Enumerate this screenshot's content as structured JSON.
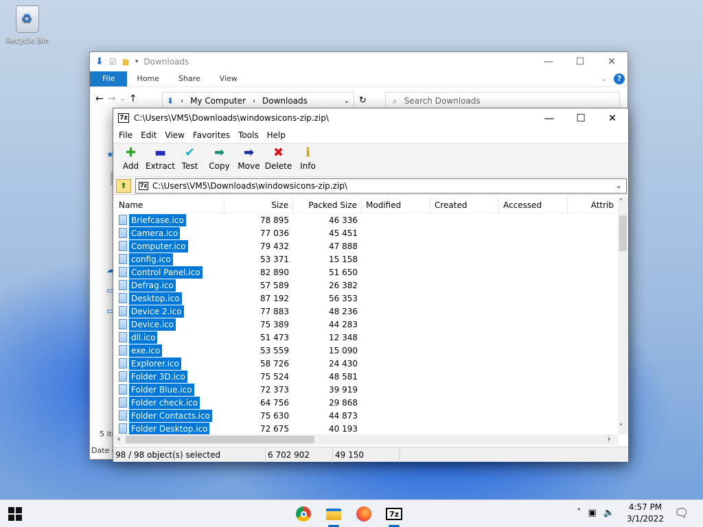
{
  "desktop": {
    "recycle_bin_label": "Recycle Bin"
  },
  "explorer": {
    "title": "Downloads",
    "ribbon_tabs": [
      "File",
      "Home",
      "Share",
      "View"
    ],
    "breadcrumb": [
      "My Computer",
      "Downloads"
    ],
    "search_placeholder": "Search Downloads",
    "status_items": "5 ite",
    "status_details": "Date c"
  },
  "sevenzip": {
    "title": "C:\\Users\\VM5\\Downloads\\windowsicons-zip.zip\\",
    "menu": [
      "File",
      "Edit",
      "View",
      "Favorites",
      "Tools",
      "Help"
    ],
    "toolbar": [
      {
        "label": "Add",
        "icon": "plus-icon",
        "color": "#2ea52e"
      },
      {
        "label": "Extract",
        "icon": "minus-icon",
        "color": "#1f2fbf"
      },
      {
        "label": "Test",
        "icon": "check-icon",
        "color": "#19b4c4"
      },
      {
        "label": "Copy",
        "icon": "arrow-right-icon",
        "color": "#1f8f7a"
      },
      {
        "label": "Move",
        "icon": "arrow-right-icon",
        "color": "#1a2aa6"
      },
      {
        "label": "Delete",
        "icon": "x-icon",
        "color": "#d01818"
      },
      {
        "label": "Info",
        "icon": "info-icon",
        "color": "#c8a400"
      }
    ],
    "path": "C:\\Users\\VM5\\Downloads\\windowsicons-zip.zip\\",
    "columns": [
      "Name",
      "Size",
      "Packed Size",
      "Modified",
      "Created",
      "Accessed",
      "Attrib"
    ],
    "files": [
      {
        "name": "Briefcase.ico",
        "size": "78 895",
        "packed": "46 336"
      },
      {
        "name": "Camera.ico",
        "size": "77 036",
        "packed": "45 451"
      },
      {
        "name": "Computer.ico",
        "size": "79 432",
        "packed": "47 888"
      },
      {
        "name": "config.ico",
        "size": "53 371",
        "packed": "15 158"
      },
      {
        "name": "Control Panel.ico",
        "size": "82 890",
        "packed": "51 650"
      },
      {
        "name": "Defrag.ico",
        "size": "57 589",
        "packed": "26 382"
      },
      {
        "name": "Desktop.ico",
        "size": "87 192",
        "packed": "56 353"
      },
      {
        "name": "Device 2.ico",
        "size": "77 883",
        "packed": "48 236"
      },
      {
        "name": "Device.ico",
        "size": "75 389",
        "packed": "44 283"
      },
      {
        "name": "dll.ico",
        "size": "51 473",
        "packed": "12 348"
      },
      {
        "name": "exe.ico",
        "size": "53 559",
        "packed": "15 090"
      },
      {
        "name": "Explorer.ico",
        "size": "58 726",
        "packed": "24 430"
      },
      {
        "name": "Folder 3D.ico",
        "size": "75 524",
        "packed": "48 581"
      },
      {
        "name": "Folder Blue.ico",
        "size": "72 373",
        "packed": "39 919"
      },
      {
        "name": "Folder check.ico",
        "size": "64 756",
        "packed": "29 868"
      },
      {
        "name": "Folder Contacts.ico",
        "size": "75 630",
        "packed": "44 873"
      },
      {
        "name": "Folder Desktop.ico",
        "size": "72 675",
        "packed": "40 193"
      }
    ],
    "status": {
      "selected": "98 / 98 object(s) selected",
      "total_size": "6 702 902",
      "packed_size": "49 150"
    }
  },
  "taskbar": {
    "time": "4:57 PM",
    "date": "3/1/2022",
    "accent": "#0067c0"
  }
}
